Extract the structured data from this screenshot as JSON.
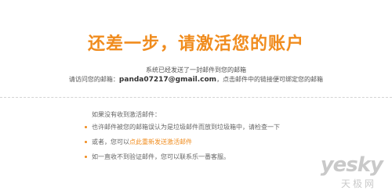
{
  "heading": "还差一步，请激活您的账户",
  "sent_notice": "系统已经发送了一封邮件到您的邮箱",
  "visit_prefix": "请访问您的邮箱：",
  "email": "panda07217@gmail.com",
  "visit_suffix": "，点击邮件中的链接便可绑定您的邮箱",
  "help": {
    "title": "如果没有收到激活邮件：",
    "tips": [
      {
        "text": "也许邮件被您的邮箱误认为是垃圾邮件而放到垃圾箱中，请检查一下"
      },
      {
        "prefix": "或者，您可以",
        "link": "点此重新发送激活邮件"
      },
      {
        "text": "如一直收不到验证邮件，您可以联系乐一番客服。"
      }
    ]
  },
  "watermark": {
    "brand": "yesky",
    "sub": "天极网"
  },
  "colors": {
    "accent": "#f08c1e"
  }
}
